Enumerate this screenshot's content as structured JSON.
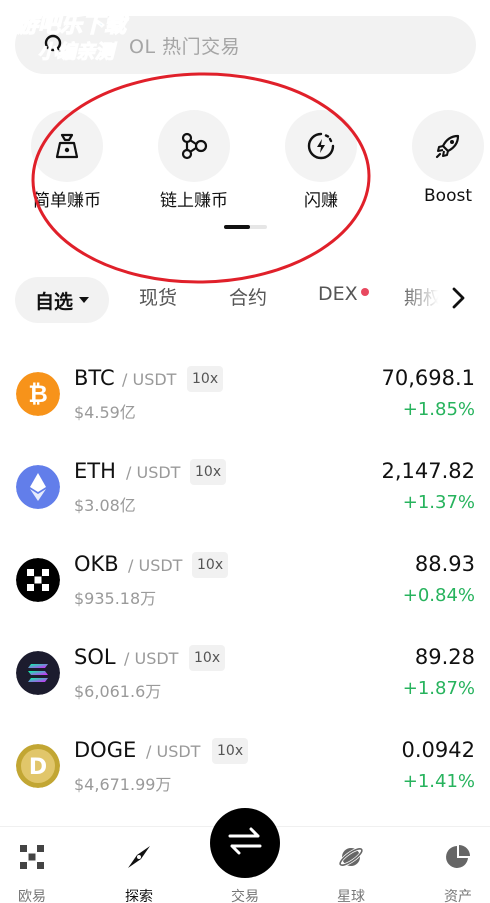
{
  "search": {
    "placeholder": "SOL 热门交易",
    "visible_text": "OL 热门交易"
  },
  "watermark": {
    "line1": "游吧乐下载",
    "line2": "小编亲测"
  },
  "shortcuts": [
    {
      "label": "简单赚币",
      "icon": "money-bag-icon"
    },
    {
      "label": "链上赚币",
      "icon": "chain-nodes-icon"
    },
    {
      "label": "闪赚",
      "icon": "flash-timer-icon"
    },
    {
      "label": "Boost",
      "icon": "rocket-icon"
    }
  ],
  "tabs": {
    "active": "自选",
    "items": [
      "现货",
      "合约",
      "DEX",
      "期权"
    ]
  },
  "market": [
    {
      "symbol": "BTC",
      "quote": "/ USDT",
      "leverage": "10x",
      "volume": "$4.59亿",
      "price": "70,698.1",
      "change": "+1.85%",
      "color": "#f7931a"
    },
    {
      "symbol": "ETH",
      "quote": "/ USDT",
      "leverage": "10x",
      "volume": "$3.08亿",
      "price": "2,147.82",
      "change": "+1.37%",
      "color": "#627eea"
    },
    {
      "symbol": "OKB",
      "quote": "/ USDT",
      "leverage": "10x",
      "volume": "$935.18万",
      "price": "88.93",
      "change": "+0.84%",
      "color": "#000000"
    },
    {
      "symbol": "SOL",
      "quote": "/ USDT",
      "leverage": "10x",
      "volume": "$6,061.6万",
      "price": "89.28",
      "change": "+1.87%",
      "color": "#1c1c2e"
    },
    {
      "symbol": "DOGE",
      "quote": "/ USDT",
      "leverage": "10x",
      "volume": "$4,671.99万",
      "price": "0.0942",
      "change": "+1.41%",
      "color": "#c2a633"
    }
  ],
  "bottom_nav": [
    {
      "label": "欧易",
      "icon": "okx-logo-icon"
    },
    {
      "label": "探索",
      "icon": "compass-icon"
    },
    {
      "label": "交易",
      "icon": "swap-arrows-icon"
    },
    {
      "label": "星球",
      "icon": "planet-icon"
    },
    {
      "label": "资产",
      "icon": "pie-chart-icon"
    }
  ],
  "colors": {
    "positive": "#27b35d",
    "annotation": "#e0202a",
    "badge": "#e8485f"
  }
}
